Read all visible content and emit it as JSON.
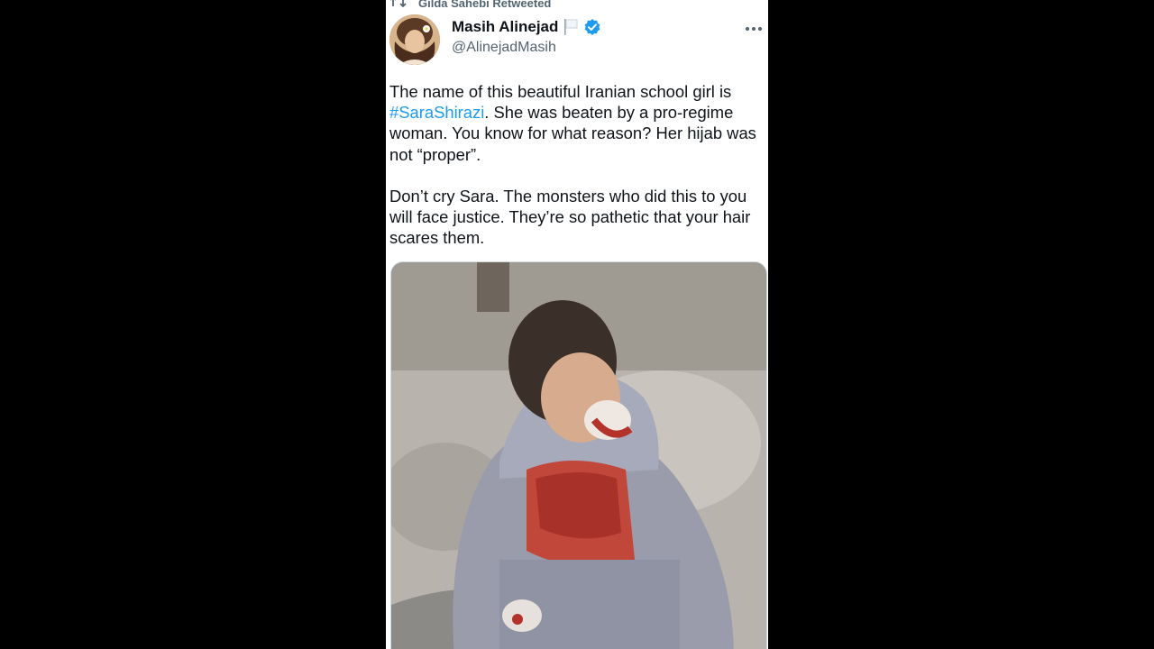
{
  "retweet": {
    "label": "Gilda Sahebi Retweeted"
  },
  "author": {
    "display_name": "Masih Alinejad",
    "handle": "@AlinejadMasih",
    "verified": true
  },
  "tweet": {
    "line1_pre": "The name of this beautiful Iranian school girl is",
    "hashtag": "#SaraShirazi",
    "line1_post": ". She was beaten by a pro-regime woman. You know for what reason? Her hijab was not “proper”.",
    "paragraph2": "Don’t cry Sara. The monsters who did this to you will face justice. They’re so pathetic that your hair scares them."
  },
  "colors": {
    "background": "#000000",
    "card": "#ffffff",
    "text": "#0f1419",
    "secondary_text": "#536471",
    "link": "#1d9bf0",
    "verified": "#1d9bf0"
  },
  "icons": {
    "retweet": "retweet-icon",
    "flag": "white-flag-icon",
    "verified": "verified-badge-icon",
    "more": "more-options-icon"
  }
}
